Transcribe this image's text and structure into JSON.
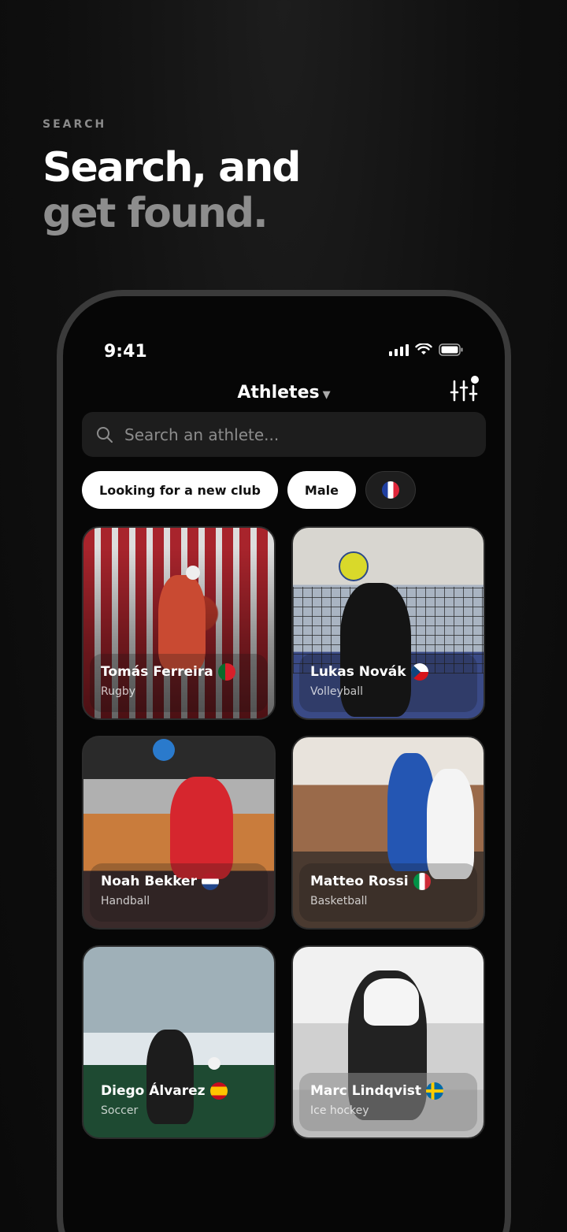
{
  "header": {
    "eyebrow": "SEARCH",
    "line1": "Search, and",
    "line2": "get found."
  },
  "status_bar": {
    "time": "9:41"
  },
  "nav": {
    "title": "Athletes"
  },
  "search": {
    "placeholder": "Search an athlete..."
  },
  "filters": [
    {
      "label": "Looking for a new club"
    },
    {
      "label": "Male"
    },
    {
      "label": "",
      "icon": "france-flag-icon"
    }
  ],
  "athletes": [
    {
      "name": "Tomás Ferreira",
      "sport": "Rugby",
      "flag": "portugal"
    },
    {
      "name": "Lukas Novák",
      "sport": "Volleyball",
      "flag": "czech"
    },
    {
      "name": "Noah Bekker",
      "sport": "Handball",
      "flag": "netherlands"
    },
    {
      "name": "Matteo Rossi",
      "sport": "Basketball",
      "flag": "italy"
    },
    {
      "name": "Diego Álvarez",
      "sport": "Soccer",
      "flag": "spain"
    },
    {
      "name": "Marc Lindqvist",
      "sport": "Ice hockey",
      "flag": "sweden"
    }
  ]
}
